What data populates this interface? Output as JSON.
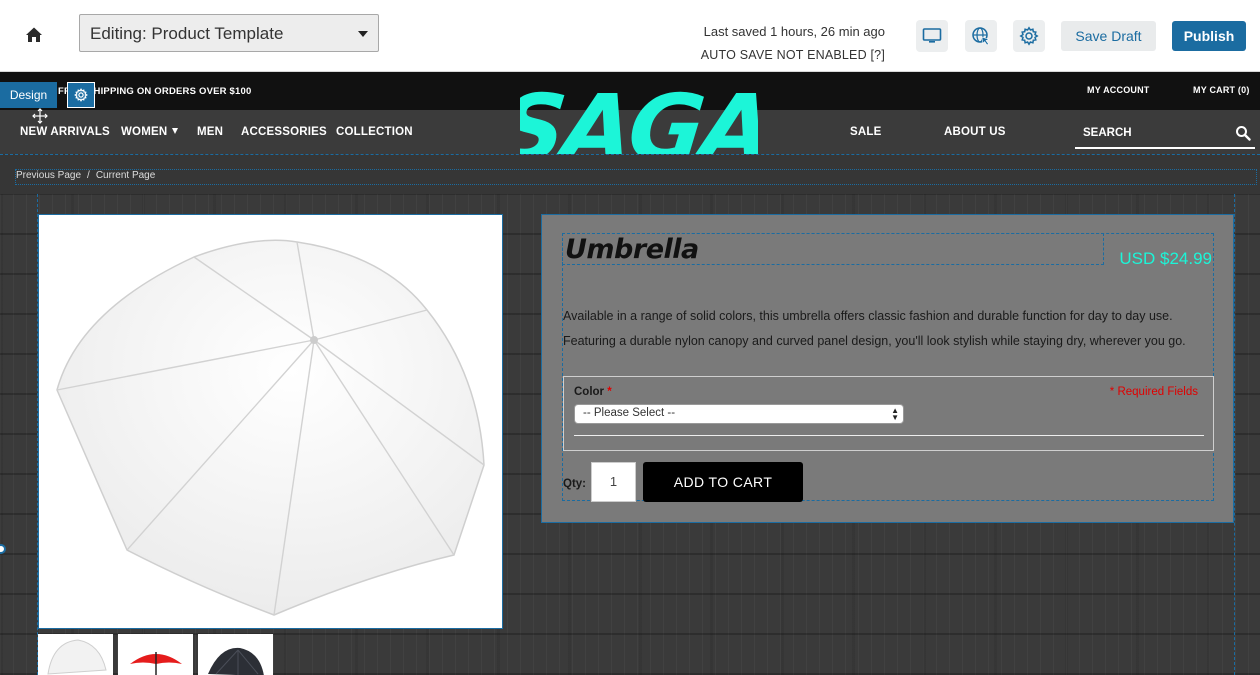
{
  "editor": {
    "template_label": "Editing: Product Template",
    "last_saved": "Last saved 1 hours, 26 min ago",
    "autosave": "AUTO SAVE NOT ENABLED [?]",
    "save_draft": "Save Draft",
    "publish": "Publish",
    "accent": "#1b6ca1",
    "icons": [
      "home-icon",
      "desktop-icon",
      "globe-cursor-icon",
      "gear-icon"
    ]
  },
  "design": {
    "tab_label": "Design"
  },
  "site": {
    "promo": "FREE SHIPPING ON ORDERS OVER $100",
    "my_account": "MY ACCOUNT",
    "my_cart": "MY CART (0)",
    "logo_text": "SAGA",
    "logo_color": "#1cf5d8",
    "nav": {
      "new_arrivals": "NEW ARRIVALS",
      "women": "WOMEN",
      "men": "MEN",
      "accessories": "ACCESSORIES",
      "collection": "COLLECTION",
      "sale": "SALE",
      "about": "ABOUT US",
      "search": "SEARCH"
    },
    "breadcrumb": {
      "previous": "Previous Page",
      "separator": "/",
      "current": "Current Page"
    }
  },
  "product": {
    "title": "Umbrella",
    "price": "USD $24.99",
    "description_1": "Available in a range of solid colors, this umbrella offers classic fashion and durable function for day to day use.",
    "description_2": "Featuring a durable nylon canopy and curved panel design, you'll look stylish while staying dry, wherever you go.",
    "color_label": "Color",
    "required_star": "*",
    "required_fields": "* Required Fields",
    "color_placeholder": "-- Please Select --",
    "qty_label": "Qty:",
    "qty_value": "1",
    "add_to_cart": "ADD TO CART",
    "thumbnails": [
      "white umbrella",
      "red umbrella",
      "black umbrella"
    ]
  }
}
